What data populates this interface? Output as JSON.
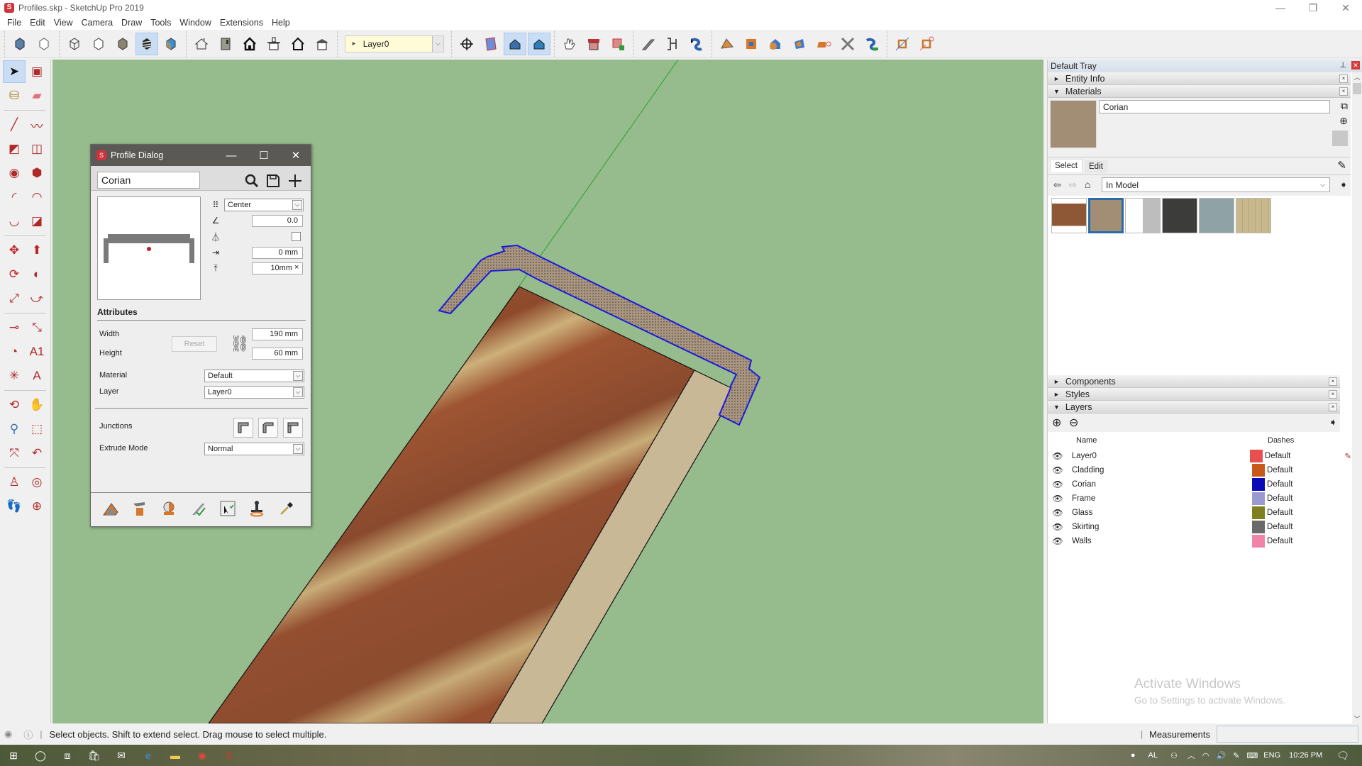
{
  "window": {
    "title": "Profiles.skp - SketchUp Pro 2019",
    "minimize_icon": "minimize-icon",
    "restore_icon": "restore-icon",
    "close_icon": "close-icon"
  },
  "menu": [
    "File",
    "Edit",
    "View",
    "Camera",
    "Draw",
    "Tools",
    "Window",
    "Extensions",
    "Help"
  ],
  "toolbar": {
    "groups": [
      [
        "xray-icon",
        "back-edges-icon"
      ],
      [
        "wireframe-icon",
        "hidden-line-icon",
        "shaded-icon",
        "shaded-textures-icon",
        "monochrome-icon"
      ],
      [
        "iso-view-icon",
        "top-view-icon",
        "front-view-icon",
        "right-view-icon",
        "back-view-icon",
        "left-view-icon"
      ],
      [
        "section-plane-icon",
        "display-section-planes-icon",
        "display-section-cuts-icon",
        "section-fill-icon"
      ],
      [
        "sandbox-hand-icon",
        "profile-builder-icon",
        "profile-builder-assembly-icon"
      ],
      [
        "build-profile-icon",
        "edit-profile-icon",
        "swept-path-icon"
      ],
      [
        "joint-push-pull-icon",
        "solid-inspector-icon",
        "intersect-icon",
        "trim-icon",
        "eraser-profile-icon",
        "knife-icon",
        "follow-me-icon"
      ],
      [
        "window-frame-icon",
        "window-frame-remove-icon"
      ]
    ],
    "layer_select": {
      "value": "Layer0"
    }
  },
  "left_tools": [
    [
      "select-icon",
      "make-component-icon"
    ],
    [
      "paint-bucket-icon",
      "eraser-icon"
    ],
    [
      "sep"
    ],
    [
      "line-icon",
      "freehand-icon"
    ],
    [
      "rectangle-icon",
      "rotated-rectangle-icon"
    ],
    [
      "circle-icon",
      "polygon-icon"
    ],
    [
      "arc-icon",
      "two-point-arc-icon"
    ],
    [
      "three-point-arc-icon",
      "pie-icon"
    ],
    [
      "sep"
    ],
    [
      "move-icon",
      "push-pull-icon"
    ],
    [
      "rotate-icon",
      "follow-me-icon"
    ],
    [
      "scale-icon",
      "offset-icon"
    ],
    [
      "sep"
    ],
    [
      "tape-measure-icon",
      "dimension-icon"
    ],
    [
      "protractor-icon",
      "text-icon"
    ],
    [
      "axes-icon",
      "3d-text-icon"
    ],
    [
      "sep"
    ],
    [
      "orbit-icon",
      "pan-icon"
    ],
    [
      "zoom-icon",
      "zoom-window-icon"
    ],
    [
      "zoom-extents-icon",
      "previous-view-icon"
    ],
    [
      "sep"
    ],
    [
      "position-camera-icon",
      "look-around-icon"
    ],
    [
      "walk-icon",
      "section-plane-icon"
    ]
  ],
  "profile_dialog": {
    "title": "Profile Dialog",
    "profile_name": "Corian",
    "alignment": "Center",
    "rotation": "0.0",
    "offset_x": "0 mm",
    "offset_y": "10mm",
    "offset_y_suffix": "×",
    "attributes_heading": "Attributes",
    "width_label": "Width",
    "width_value": "190 mm",
    "height_label": "Height",
    "height_value": "60 mm",
    "reset_label": "Reset",
    "material_label": "Material",
    "material_value": "Default",
    "layer_label": "Layer",
    "layer_value": "Layer0",
    "junctions_label": "Junctions",
    "extrude_mode_label": "Extrude Mode",
    "extrude_mode_value": "Normal"
  },
  "tray": {
    "title": "Default Tray",
    "panels": {
      "entity_info": "Entity Info",
      "materials": "Materials",
      "components": "Components",
      "styles": "Styles",
      "layers": "Layers"
    },
    "materials": {
      "name": "Corian",
      "tab_select": "Select",
      "tab_edit": "Edit",
      "collection": "In Model",
      "swatches": [
        {
          "name": "brick",
          "color": "#8e5836"
        },
        {
          "name": "corian",
          "color": "#a28e74"
        },
        {
          "name": "glass",
          "color": "#c9c9c9"
        },
        {
          "name": "dark-grey",
          "color": "#3c3d3b"
        },
        {
          "name": "concrete",
          "color": "#8fa2a5"
        },
        {
          "name": "wood-panel",
          "color": "#c8b88d"
        }
      ]
    },
    "layers": {
      "col_name": "Name",
      "col_dashes": "Dashes",
      "rows": [
        {
          "name": "Layer0",
          "color": "#e8504f",
          "dashes": "Default",
          "current": true
        },
        {
          "name": "Cladding",
          "color": "#c8581c",
          "dashes": "Default"
        },
        {
          "name": "Corian",
          "color": "#0a0ab8",
          "dashes": "Default"
        },
        {
          "name": "Frame",
          "color": "#9b9ad0",
          "dashes": "Default"
        },
        {
          "name": "Glass",
          "color": "#7f7f1e",
          "dashes": "Default"
        },
        {
          "name": "Skirting",
          "color": "#6a6a6a",
          "dashes": "Default"
        },
        {
          "name": "Walls",
          "color": "#ef84a8",
          "dashes": "Default"
        }
      ]
    },
    "watermark_title": "Activate Windows",
    "watermark_sub": "Go to Settings to activate Windows."
  },
  "status": {
    "message": "Select objects. Shift to extend select. Drag mouse to select multiple.",
    "measurements_label": "Measurements",
    "measurements_value": ""
  },
  "taskbar": {
    "time": "10:26 PM",
    "lang": "ENG"
  },
  "colors": {
    "viewport_bg": "#96bb8c",
    "selection_blue": "#1a1adf",
    "axis_green": "#2ea02e"
  }
}
